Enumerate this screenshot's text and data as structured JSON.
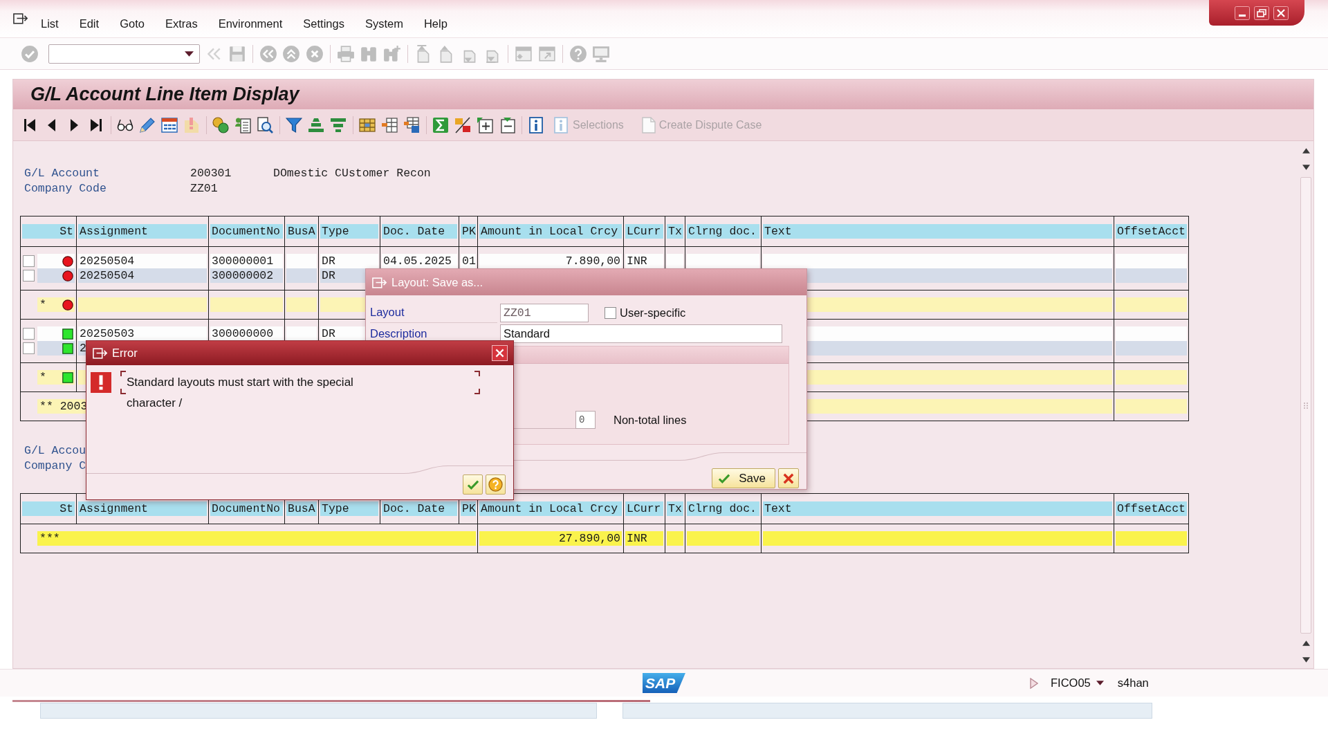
{
  "menu_bar": {
    "items": [
      "List",
      "Edit",
      "Goto",
      "Extras",
      "Environment",
      "Settings",
      "System",
      "Help"
    ]
  },
  "title": "G/L Account Line Item Display",
  "app_toolbar": {
    "buttons": [
      {
        "label": "Selections",
        "disabled": true
      },
      {
        "label": "Create Dispute Case",
        "disabled": true
      }
    ]
  },
  "sections": [
    {
      "header": [
        {
          "label": "G/L Account",
          "value": "200301",
          "description": "DOmestic CUstomer Recon"
        },
        {
          "label": "Company Code",
          "value": "ZZ01"
        }
      ],
      "table": {
        "columns": [
          "St",
          "Assignment",
          "DocumentNo",
          "BusA",
          "Type",
          "Doc. Date",
          "PK",
          "Amount in Local Crcy",
          "LCurr",
          "Tx",
          "Clrng doc.",
          "Text",
          "OffsetAcct"
        ],
        "groups": [
          {
            "rows": [
              {
                "kind": "item",
                "checked": false,
                "cleared": false,
                "assignment": "20250504",
                "document_no": "300000001",
                "type": "DR",
                "doc_date": "04.05.2025",
                "pk": "01",
                "amount": "7.890,00",
                "lcurr": "INR"
              },
              {
                "kind": "item",
                "checked": false,
                "cleared": false,
                "assignment": "20250504",
                "document_no": "300000002",
                "type": "DR"
              }
            ]
          },
          {
            "rows": [
              {
                "kind": "subtotal",
                "marker": "*",
                "cleared": false
              }
            ]
          },
          {
            "rows": [
              {
                "kind": "item",
                "checked": false,
                "cleared": true,
                "assignment": "20250503",
                "document_no": "300000000",
                "type": "DR"
              },
              {
                "kind": "item",
                "checked": false,
                "cleared": true,
                "assignment": "2"
              }
            ]
          },
          {
            "rows": [
              {
                "kind": "subtotal",
                "marker": "*",
                "cleared": true
              }
            ]
          },
          {
            "rows": [
              {
                "kind": "group_total",
                "label": "** 2003"
              }
            ]
          }
        ]
      }
    },
    {
      "header": [
        {
          "label": "G/L Accou"
        },
        {
          "label": "Company C"
        }
      ],
      "table": {
        "columns": [
          "St",
          "Assignment",
          "DocumentNo",
          "BusA",
          "Type",
          "Doc. Date",
          "PK",
          "Amount in Local Crcy",
          "LCurr",
          "Tx",
          "Clrng doc.",
          "Text",
          "OffsetAcct"
        ],
        "groups": [
          {
            "rows": [
              {
                "kind": "grand_total",
                "label": "***",
                "amount": "27.890,00",
                "lcurr": "INR"
              }
            ]
          }
        ]
      }
    }
  ],
  "layout_dialog": {
    "title": "Layout: Save as...",
    "fields": [
      {
        "label": "Layout",
        "value": "ZZ01"
      },
      {
        "label": "Description",
        "value": "Standard"
      }
    ],
    "user_specific": {
      "label": "User-specific",
      "checked": false
    },
    "non_total_lines": {
      "value": "0",
      "label": "Non-total lines"
    },
    "buttons": [
      {
        "kind": "save",
        "label": "Save"
      },
      {
        "kind": "cancel"
      }
    ]
  },
  "error_dialog": {
    "title": "Error",
    "message": "Standard layouts must start with the special character /",
    "buttons": [
      {
        "kind": "confirm"
      },
      {
        "kind": "help"
      }
    ]
  },
  "status_bar": {
    "logo": "SAP",
    "system": "FICO05",
    "server": "s4han"
  }
}
